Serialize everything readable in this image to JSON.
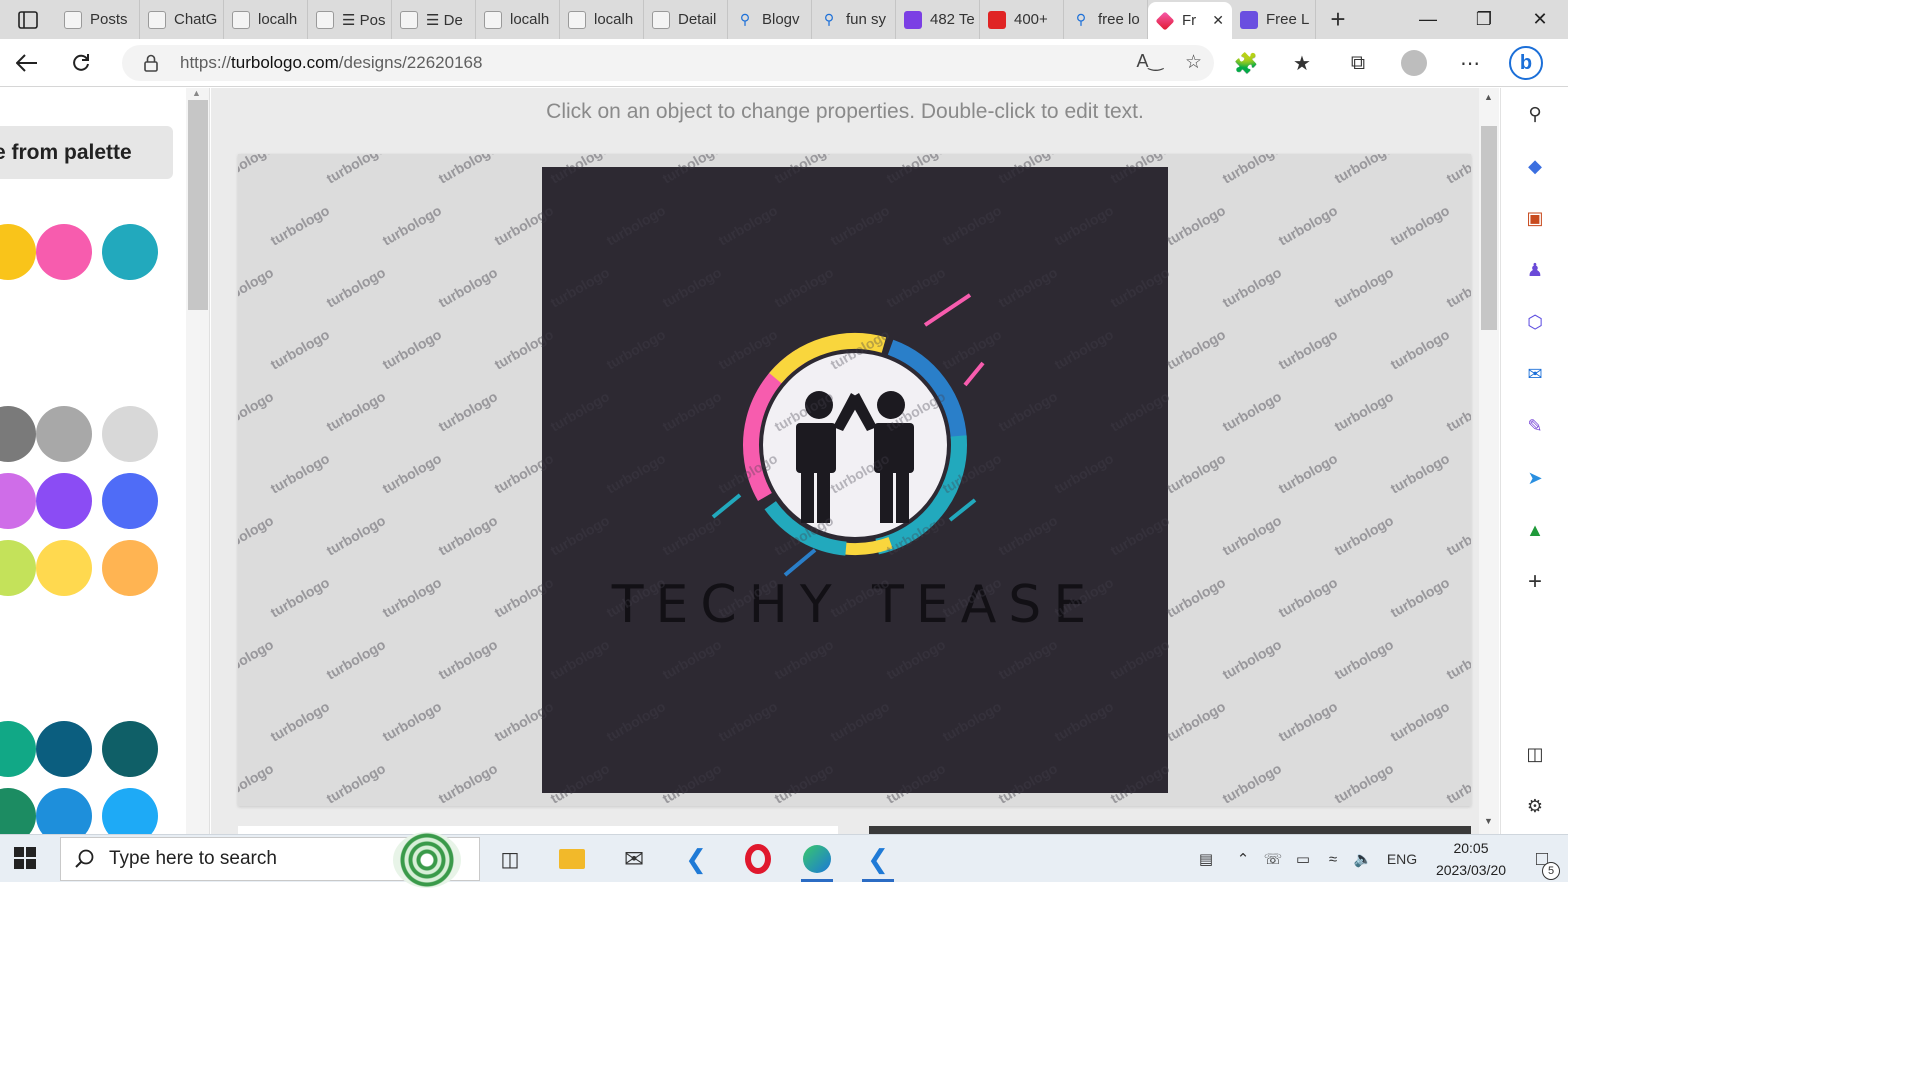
{
  "browser": {
    "tabs": [
      {
        "label": "Posts",
        "icon": "page-icon"
      },
      {
        "label": "ChatG",
        "icon": "chatgpt-icon"
      },
      {
        "label": "localh",
        "icon": "page-icon"
      },
      {
        "label": "☰ Pos",
        "icon": "page-icon"
      },
      {
        "label": "☰ De",
        "icon": "page-icon"
      },
      {
        "label": "localh",
        "icon": "page-icon"
      },
      {
        "label": "localh",
        "icon": "page-icon"
      },
      {
        "label": "Detail",
        "icon": "page-icon"
      },
      {
        "label": "Blogv",
        "icon": "search-icon"
      },
      {
        "label": "fun sy",
        "icon": "search-icon"
      },
      {
        "label": "482 Te",
        "icon": "s-logo-icon",
        "color": "#7b3fe4"
      },
      {
        "label": "400+",
        "icon": "badge-icon",
        "color": "#e02424"
      },
      {
        "label": "free lo",
        "icon": "search-icon"
      },
      {
        "label": "Fr",
        "icon": "turbologo-icon",
        "active": true
      },
      {
        "label": "Free L",
        "icon": "site-icon",
        "color": "#6a4fe0"
      }
    ],
    "url_prefix": "https://",
    "url_host": "turbologo.com",
    "url_path": "/designs/22620168"
  },
  "editor": {
    "hint": "Click on an object to change properties. Double-click to edit text.",
    "palette_button": "e from palette",
    "swatch_colors": [
      {
        "color": "#f9c41a"
      },
      {
        "color": "#f75cae"
      },
      {
        "color": "#22a9bd"
      },
      {
        "color": "#7a7a7a"
      },
      {
        "color": "#a8a8a8"
      },
      {
        "color": "#d8d8d8"
      },
      {
        "color": "#cf6de8"
      },
      {
        "color": "#8b4cf4"
      },
      {
        "color": "#4f6cf7"
      },
      {
        "color": "#c4e25a"
      },
      {
        "color": "#ffd94f"
      },
      {
        "color": "#ffb452"
      },
      {
        "color": "#11a886"
      },
      {
        "color": "#0b5e7f"
      },
      {
        "color": "#0f5f67"
      },
      {
        "color": "#1c8c62"
      },
      {
        "color": "#1e8fdb"
      },
      {
        "color": "#1eaaf6"
      }
    ],
    "watermark": "turbologo",
    "design": {
      "background": "#2d2932",
      "logo_text": "TECHY TEASE",
      "ring_colors": [
        "#f75cae",
        "#f9d63d",
        "#22a9bd",
        "#2a7fc9"
      ]
    }
  },
  "taskbar": {
    "search_placeholder": "Type here to search",
    "language": "ENG",
    "time": "20:05",
    "date": "2023/03/20",
    "notifications": "5"
  }
}
